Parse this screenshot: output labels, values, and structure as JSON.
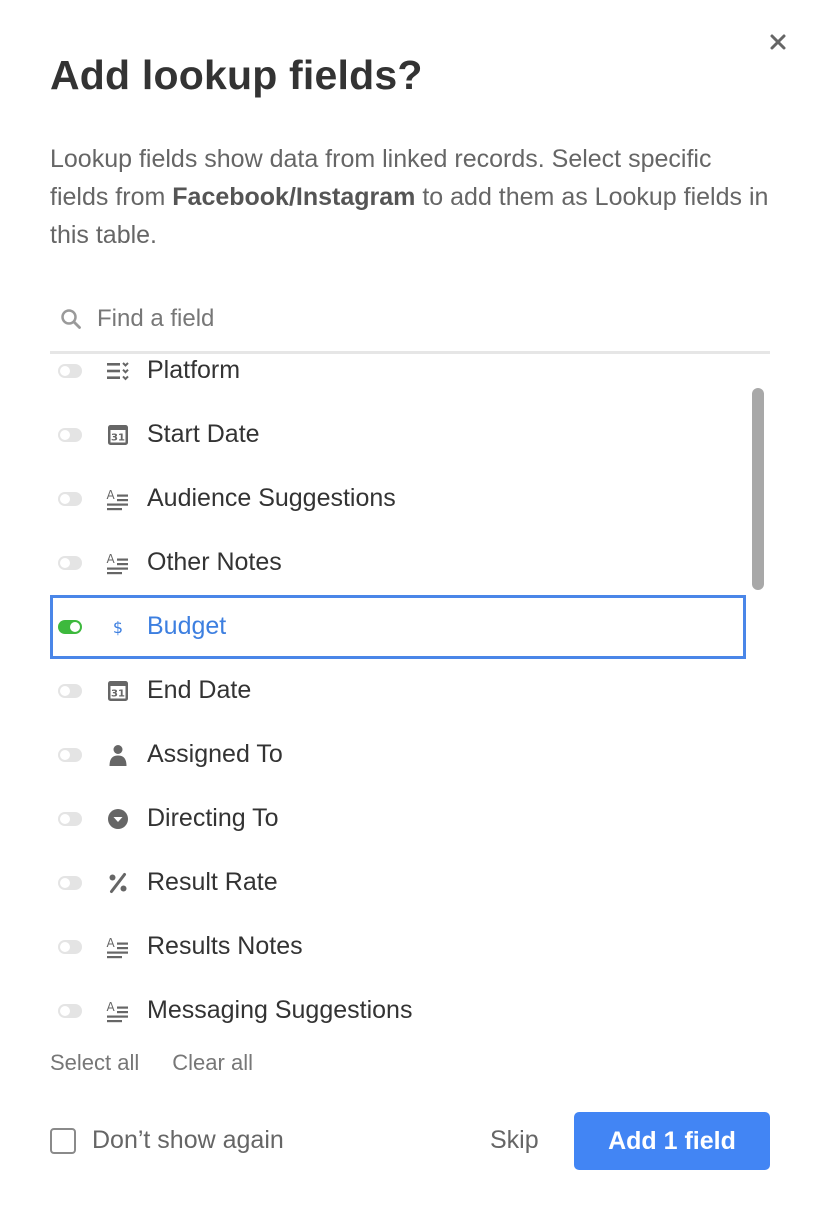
{
  "dialog": {
    "title": "Add lookup fields?",
    "description_before": "Lookup fields show data from linked records. Select specific fields from ",
    "description_bold": "Facebook/Instagram",
    "description_after": " to add them as Lookup fields in this table."
  },
  "search": {
    "placeholder": "Find a field",
    "value": ""
  },
  "fields": [
    {
      "label": "Platform",
      "icon": "multi-select-icon",
      "enabled": false
    },
    {
      "label": "Start Date",
      "icon": "calendar-icon",
      "enabled": false
    },
    {
      "label": "Audience Suggestions",
      "icon": "long-text-icon",
      "enabled": false
    },
    {
      "label": "Other Notes",
      "icon": "long-text-icon",
      "enabled": false
    },
    {
      "label": "Budget",
      "icon": "currency-icon",
      "enabled": true
    },
    {
      "label": "End Date",
      "icon": "calendar-icon",
      "enabled": false
    },
    {
      "label": "Assigned To",
      "icon": "user-icon",
      "enabled": false
    },
    {
      "label": "Directing To",
      "icon": "single-select-icon",
      "enabled": false
    },
    {
      "label": "Result Rate",
      "icon": "percent-icon",
      "enabled": false
    },
    {
      "label": "Results Notes",
      "icon": "long-text-icon",
      "enabled": false
    },
    {
      "label": "Messaging Suggestions",
      "icon": "long-text-icon",
      "enabled": false
    }
  ],
  "calendar_day": "31",
  "links": {
    "select_all": "Select all",
    "clear_all": "Clear all"
  },
  "footer": {
    "dont_show_again": "Don’t show again",
    "dont_show_checked": false,
    "skip": "Skip",
    "primary": "Add 1 field"
  },
  "colors": {
    "accent": "#4285f4",
    "toggle_on": "#3db93d",
    "selected_outline": "#4a86e8"
  }
}
